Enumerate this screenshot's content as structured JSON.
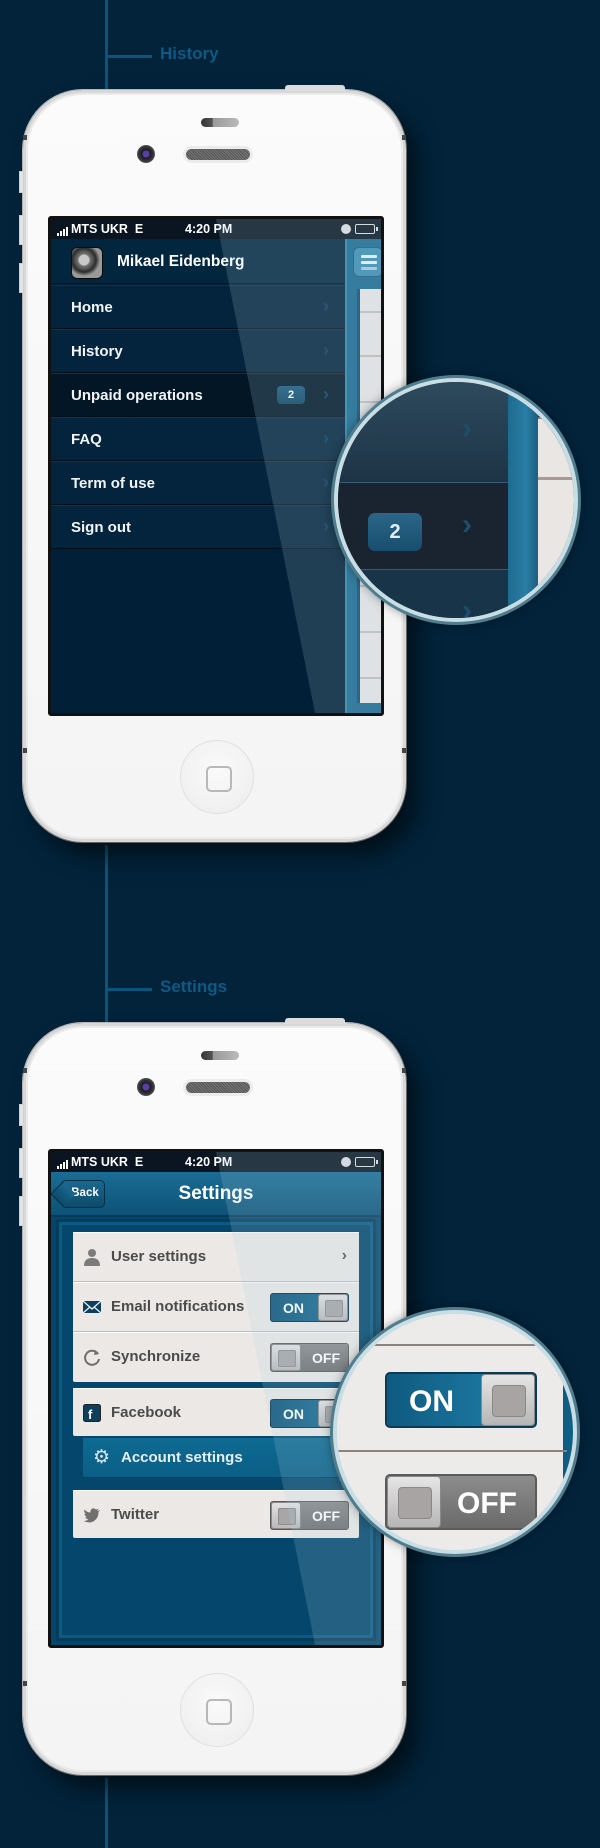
{
  "sections": [
    {
      "label": "History"
    },
    {
      "label": "Settings"
    }
  ],
  "status_bar": {
    "carrier": "MTS UKR",
    "network": "E",
    "time": "4:20 PM",
    "icons": [
      "signal-icon",
      "clock-icon",
      "battery-icon"
    ]
  },
  "menu_screen": {
    "user_name": "Mikael Eidenberg",
    "menu_button_icon": "hamburger-icon",
    "items": [
      {
        "label": "Home",
        "badge": null,
        "active": false
      },
      {
        "label": "History",
        "badge": null,
        "active": false
      },
      {
        "label": "Unpaid operations",
        "badge": "2",
        "active": true
      },
      {
        "label": "FAQ",
        "badge": null,
        "active": false
      },
      {
        "label": "Term of use",
        "badge": null,
        "active": false
      },
      {
        "label": "Sign out",
        "badge": null,
        "active": false
      }
    ],
    "magnifier": {
      "badge": "2"
    }
  },
  "settings_screen": {
    "back_label": "Back",
    "title": "Settings",
    "group1": [
      {
        "icon": "user-icon",
        "label": "User settings",
        "type": "link"
      },
      {
        "icon": "envelope-icon",
        "label": "Email notifications",
        "type": "toggle",
        "state": "ON"
      },
      {
        "icon": "refresh-icon",
        "label": "Synchronize",
        "type": "toggle",
        "state": "OFF"
      }
    ],
    "facebook": {
      "icon": "facebook-icon",
      "label": "Facebook",
      "state": "ON"
    },
    "account_settings": {
      "icon": "gear-icon",
      "label": "Account settings"
    },
    "twitter": {
      "icon": "twitter-icon",
      "label": "Twitter",
      "state": "OFF"
    },
    "magnifier": {
      "on_label": "ON",
      "off_label": "OFF"
    }
  },
  "colors": {
    "background": "#02233a",
    "accent": "#0e5a84",
    "toggle_on": "#0d5377",
    "toggle_off": "#7a7a7a"
  }
}
